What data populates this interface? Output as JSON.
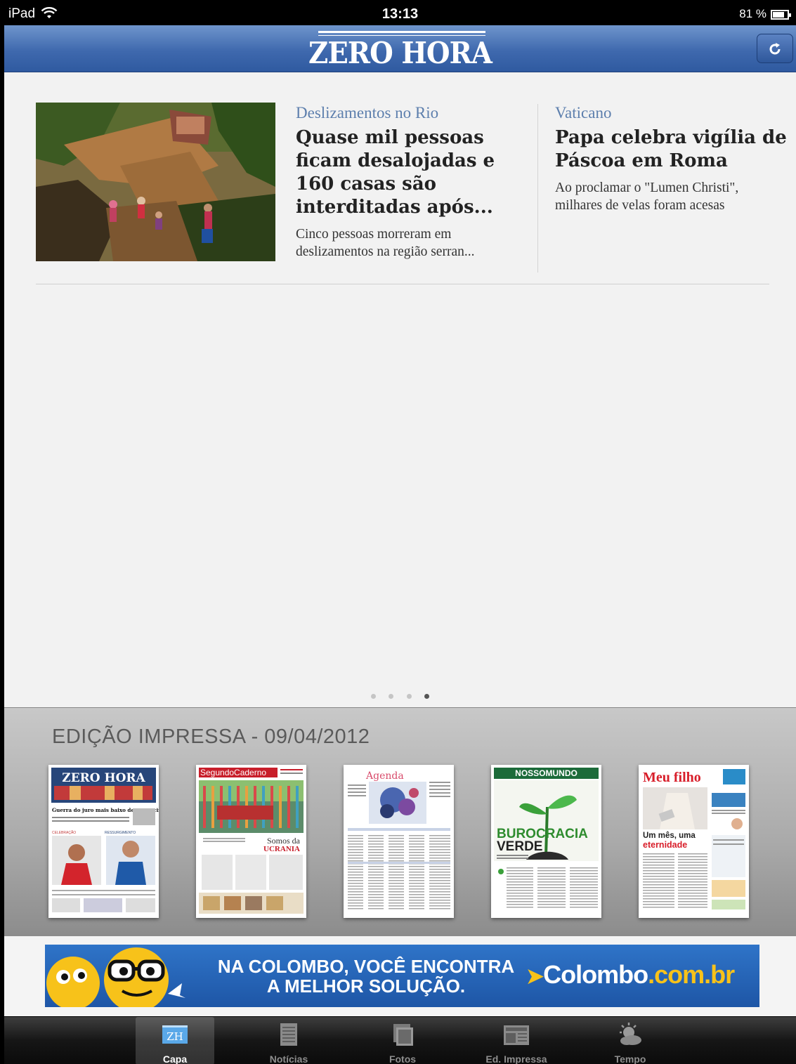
{
  "status_bar": {
    "device": "iPad",
    "time": "13:13",
    "battery": "81 %",
    "battery_level": 0.81
  },
  "nav": {
    "logo": "ZERO HORA",
    "refresh_icon": "refresh-icon"
  },
  "stories": [
    {
      "kicker": "Deslizamentos no Rio",
      "headline": "Quase mil pessoas ficam desalojadas e 160 casas são interditadas após...",
      "summary": "Cinco pessoas morreram em deslizamentos na região serran..."
    },
    {
      "kicker": "Vaticano",
      "headline": "Papa celebra vigília de Páscoa em Roma",
      "summary": "Ao proclamar o \"Lumen Christi\", milhares de velas foram acesas"
    }
  ],
  "pager": {
    "pages": 4,
    "active": 4
  },
  "print_edition": {
    "title": "EDIÇÃO IMPRESSA - 09/04/2012",
    "covers": [
      {
        "name": "ZERO HORA",
        "headline": "Guerra do juro mais baixo deve se acirrar no Estado",
        "tag1": "CELEBRAÇÃO",
        "tag2": "RESSURGIMENTO"
      },
      {
        "name": "SegundoCaderno",
        "headline": "Somos da",
        "headline2": "UCRANIA"
      },
      {
        "name": "Agenda"
      },
      {
        "name": "NOSSOMUNDO",
        "headline": "BUROCRACIA",
        "headline2": "VERDE"
      },
      {
        "name": "Meu filho",
        "headline": "Um mês, uma",
        "headline2": "eternidade"
      }
    ]
  },
  "banner": {
    "line1": "NA COLOMBO, VOCÊ ENCONTRA",
    "line2": "A MELHOR SOLUÇÃO.",
    "brand": "Colombo",
    "brand_suffix": ".com.br"
  },
  "tabs": [
    {
      "label": "Capa",
      "icon": "zh-logo-icon",
      "selected": true
    },
    {
      "label": "Notícias",
      "icon": "document-icon",
      "selected": false
    },
    {
      "label": "Fotos",
      "icon": "photos-icon",
      "selected": false
    },
    {
      "label": "Ed. Impressa",
      "icon": "newspaper-icon",
      "selected": false
    },
    {
      "label": "Tempo",
      "icon": "weather-icon",
      "selected": false
    }
  ]
}
